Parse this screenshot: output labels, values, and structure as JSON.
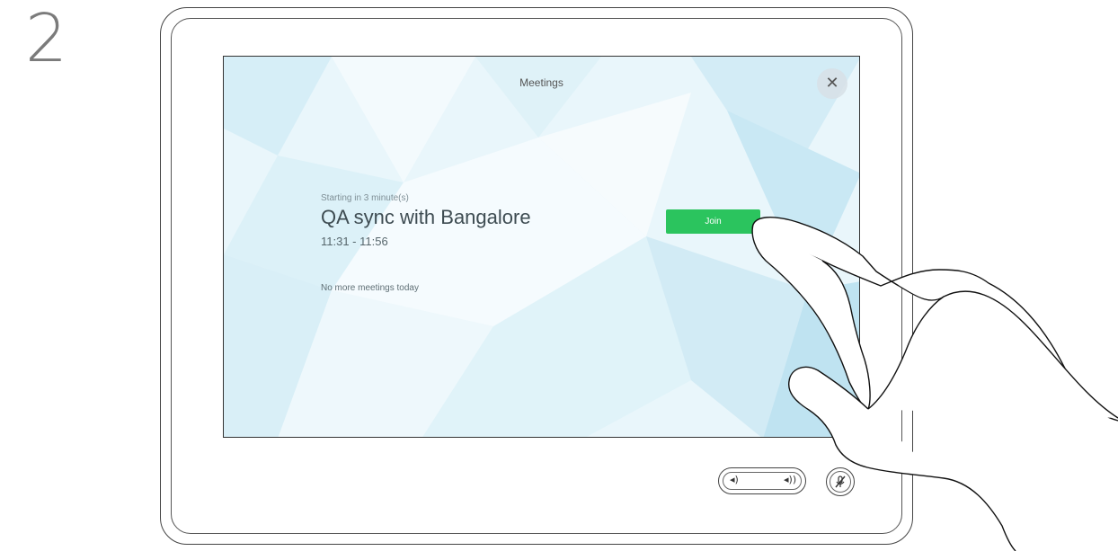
{
  "step": {
    "number": "2"
  },
  "screen": {
    "title": "Meetings",
    "close_icon": "close-icon",
    "meeting": {
      "status": "Starting in 3 minute(s)",
      "title": "QA sync with Bangalore",
      "time": "11:31 - 11:56",
      "join_label": "Join",
      "join_color": "#2bc45e"
    },
    "no_more": "No more meetings today"
  },
  "controls": {
    "volume_down_icon": "volume-down-icon",
    "volume_up_icon": "volume-up-icon",
    "mute_icon": "microphone-muted-icon"
  }
}
